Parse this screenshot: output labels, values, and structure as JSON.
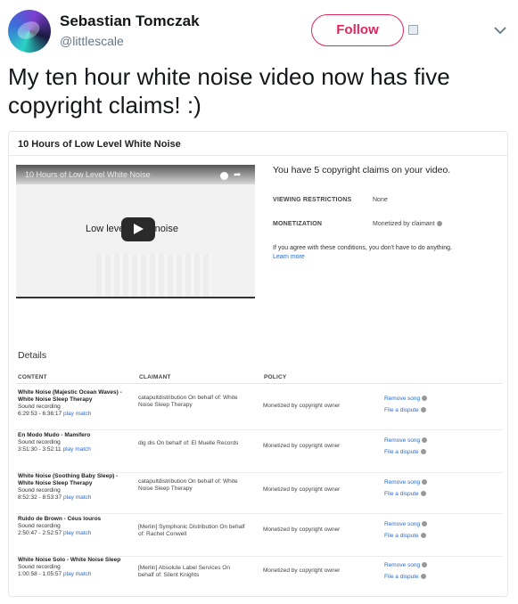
{
  "tweet": {
    "name": "Sebastian Tomczak",
    "handle": "@littlescale",
    "follow_label": "Follow",
    "text": "My ten hour white noise video now has five copyright claims! :)"
  },
  "card": {
    "title": "10 Hours of Low Level White Noise",
    "video": {
      "title": "10 Hours of Low Level White Noise",
      "caption": "Low level white noise"
    },
    "claims_heading": "You have 5 copyright claims on your video.",
    "viewing_restrictions_label": "VIEWING RESTRICTIONS",
    "viewing_restrictions_value": "None",
    "monetization_label": "MONETIZATION",
    "monetization_value": "Monetized by claimant",
    "note": "If you agree with these conditions, you don't have to do anything.",
    "learn_more": "Learn more",
    "details_title": "Details",
    "columns": [
      "CONTENT",
      "CLAIMANT",
      "POLICY"
    ],
    "rows": [
      {
        "song": "White Noise (Majestic Ocean Waves) - White Noise Sleep Therapy",
        "type": "Sound recording",
        "time": "6:29:53 - 6:36:17",
        "match": "play match",
        "claimant": "catapultdistribution On behalf of: White Noise Sleep Therapy",
        "policy": "Monetized by copyright owner",
        "remove": "Remove song",
        "dispute": "File a dispute"
      },
      {
        "song": "En Modo Mudo - Mamifero",
        "type": "Sound recording",
        "time": "3:51:30 - 3:52:11",
        "match": "play match",
        "claimant": "dig dis On behalf of: El Muelle Records",
        "policy": "Monetized by copyright owner",
        "remove": "Remove song",
        "dispute": "File a dispute"
      },
      {
        "song": "White Noise (Soothing Baby Sleep) - White Noise Sleep Therapy",
        "type": "Sound recording",
        "time": "8:52:32 - 8:53:37",
        "match": "play match",
        "claimant": "catapultdistribution On behalf of: White Noise Sleep Therapy",
        "policy": "Monetized by copyright owner",
        "remove": "Remove song",
        "dispute": "File a dispute"
      },
      {
        "song": "Ruido de Brown - Céus louros",
        "type": "Sound recording",
        "time": "2:50:47 - 2:52:57",
        "match": "play match",
        "claimant": "[Merlin] Symphonic Distribution On behalf of: Rachel Conwell",
        "policy": "Monetized by copyright owner",
        "remove": "Remove song",
        "dispute": "File a dispute"
      },
      {
        "song": "White Noise Solo - White Noise Sleep",
        "type": "Sound recording",
        "time": "1:00:58 - 1:05:57",
        "match": "play match",
        "claimant": "[Merlin] Absolute Label Services On behalf of: Silent Knights",
        "policy": "Monetized by copyright owner",
        "remove": "Remove song",
        "dispute": "File a dispute"
      }
    ]
  },
  "colors": {
    "follow_accent": "#e0245e",
    "link_blue": "#2a6ad1",
    "handle_gray": "#657786"
  },
  "icons": [
    "chevron-down-icon",
    "play-icon",
    "clock-icon",
    "share-icon",
    "info-icon"
  ]
}
